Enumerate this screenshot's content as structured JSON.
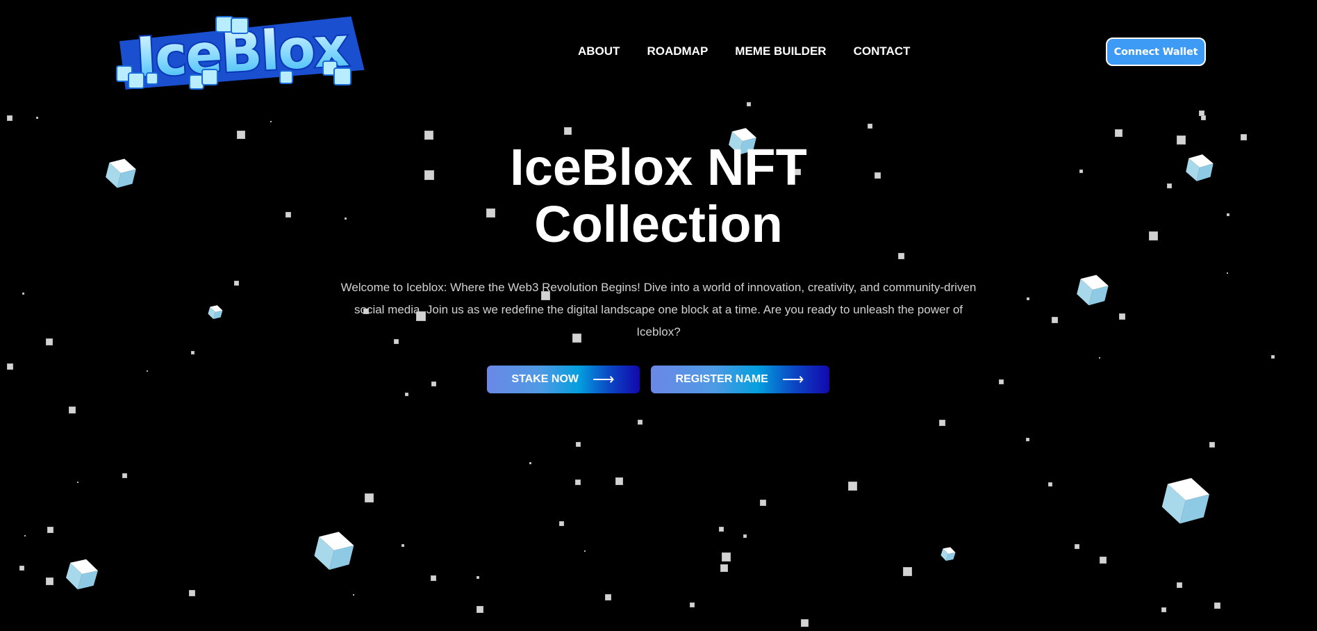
{
  "header": {
    "logo_alt": "IceBlox",
    "logo_text": "IceBlox",
    "nav": [
      {
        "label": "ABOUT"
      },
      {
        "label": "ROADMAP"
      },
      {
        "label": "MEME BUILDER"
      },
      {
        "label": "CONTACT"
      }
    ],
    "wallet_button": "Connect Wallet"
  },
  "hero": {
    "title_line1": "IceBlox NFT",
    "title_line2": "Collection",
    "description": "Welcome to Iceblox: Where the Web3 Revolution Begins! Dive into a world of innovation, creativity, and community-driven social media. Join us as we redefine the digital landscape one block at a time. Are you ready to unleash the power of Iceblox?",
    "buttons": [
      {
        "label": "STAKE NOW",
        "icon": "arrow-right-icon",
        "arrow": "⟶"
      },
      {
        "label": "REGISTER NAME",
        "icon": "arrow-right-icon",
        "arrow": "⟶"
      }
    ]
  },
  "colors": {
    "background": "#000000",
    "accent": "#3d9bf5",
    "cube_top": "#ffffff",
    "cube_left": "#a8d9ea",
    "cube_right": "#8ecae4",
    "particle": "#d3d3d3",
    "gradient_start": "#6b88e6",
    "gradient_mid": "#049fdf",
    "gradient_end": "#1208ad"
  },
  "background": {
    "cube_icon": "ice-cube-icon",
    "particle_icon": "pixel-particle"
  }
}
